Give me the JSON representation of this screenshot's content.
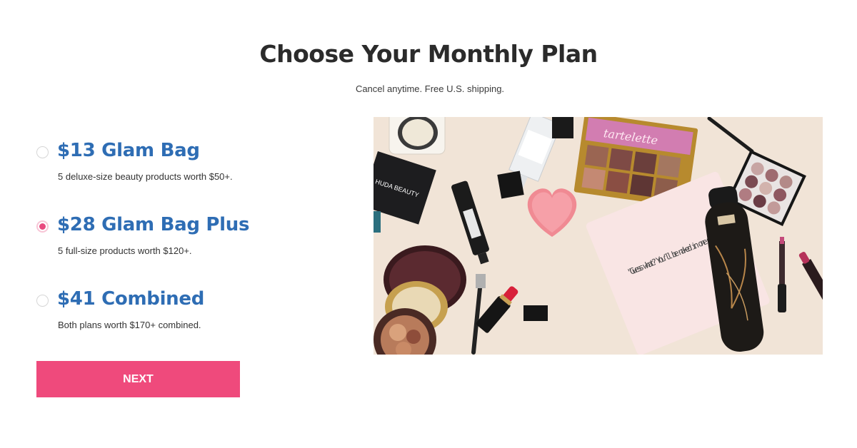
{
  "header": {
    "title": "Choose Your Monthly Plan",
    "subtitle": "Cancel anytime. Free U.S. shipping."
  },
  "plans": [
    {
      "name": "$13 Glam Bag",
      "description": "5 deluxe-size beauty products worth $50+.",
      "selected": false
    },
    {
      "name": "$28 Glam Bag Plus",
      "description": "5 full-size products worth $120+.",
      "selected": true
    },
    {
      "name": "$41 Combined",
      "description": "Both plans worth $170+ combined.",
      "selected": false
    }
  ],
  "next_button": {
    "label": "NEXT"
  },
  "product_photo": {
    "brand_huda": "HUDA BEAUTY",
    "brand_tarte": "tartelette",
    "bag_text": "\"Guess what? You'll be naked in one minute.\"",
    "colors": {
      "background": "#f1e4d7",
      "accent": "#ef4a7c",
      "plan_name": "#2e6db4"
    }
  }
}
